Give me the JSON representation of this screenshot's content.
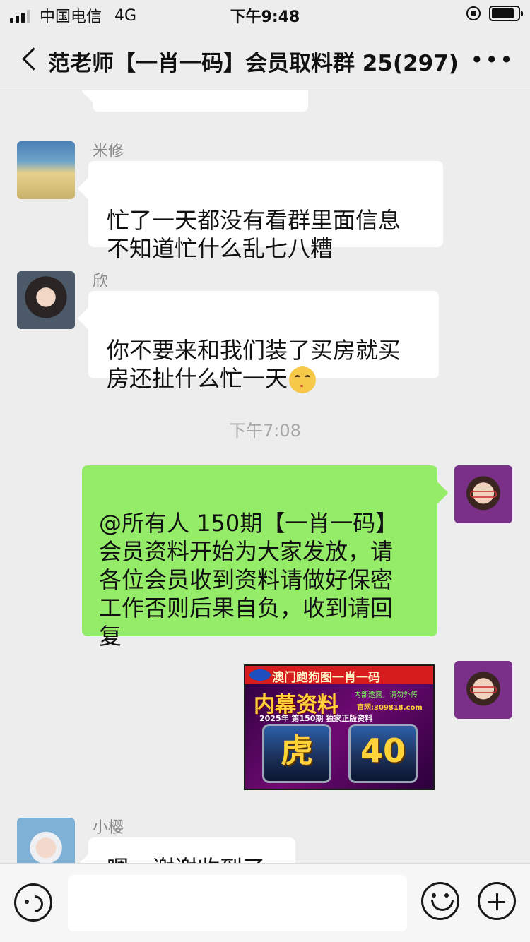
{
  "status_bar": {
    "carrier": "中国电信",
    "network": "4G",
    "time": "下午9:48"
  },
  "nav": {
    "title": "范老师【一肖一码】会员取料群 25(297)",
    "more": "•••"
  },
  "messages": [
    {
      "sender": "米修",
      "text": "忙了一天都没有看群里面信息\n不知道忙什么乱七八糟"
    },
    {
      "sender": "欣",
      "text": "你不要来和我们装了买房就买\n房还扯什么忙一天"
    },
    {
      "timestamp": "下午7:08"
    },
    {
      "text": "@所有人 150期【一肖一码】\n会员资料开始为大家发放，请\n各位会员收到资料请做好保密\n工作否则后果自负，收到请回\n复"
    },
    {
      "image": {
        "header": "澳门跑狗图一肖一码",
        "title": "内幕资料",
        "slogan": "内部透露，请勿外传",
        "website": "官网:309818.com",
        "issue": "2025年 第150期 独家正版资料",
        "zodiac": "虎",
        "number": "40"
      }
    },
    {
      "sender": "小樱",
      "text": "嗯，谢谢收到了"
    }
  ]
}
